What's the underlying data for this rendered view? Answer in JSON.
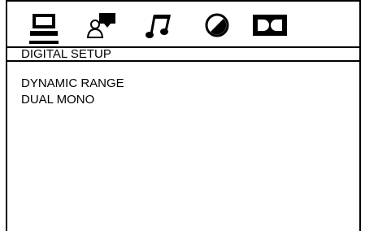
{
  "icons": [
    {
      "name": "general-setup-icon",
      "active": true
    },
    {
      "name": "speaker-setup-icon",
      "active": false
    },
    {
      "name": "audio-setup-icon",
      "active": false
    },
    {
      "name": "preferences-icon",
      "active": false
    },
    {
      "name": "dolby-digital-icon",
      "active": false
    }
  ],
  "page_title": "DIGITAL SETUP",
  "menu": {
    "items": [
      {
        "label": "DYNAMIC RANGE"
      },
      {
        "label": "DUAL MONO"
      }
    ]
  }
}
